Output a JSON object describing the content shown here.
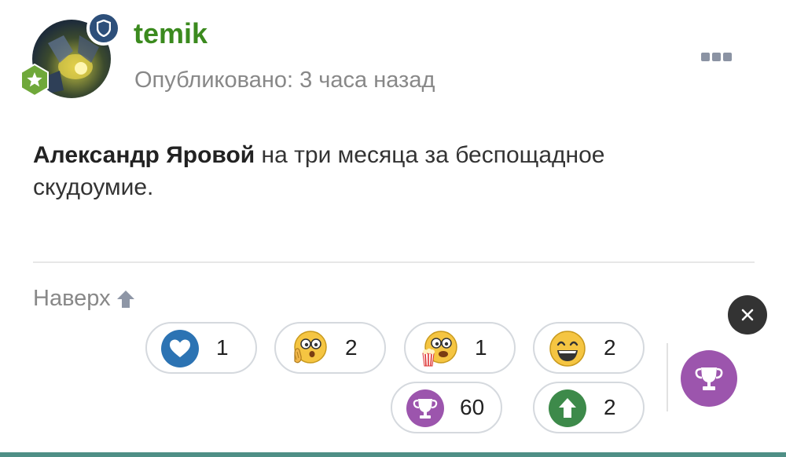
{
  "post": {
    "username": "temik",
    "published": "Опубликовано: 3 часа назад",
    "text_bold": "Александр Яровой",
    "text_rest": " на три месяца за беспощадное скудоумие."
  },
  "nav": {
    "to_top": "Наверх"
  },
  "reactions": [
    {
      "name": "heart",
      "count": "1",
      "color": "#2c73b3"
    },
    {
      "name": "shocked-face",
      "count": "2",
      "color": "#f5c542"
    },
    {
      "name": "popcorn-face",
      "count": "1",
      "color": "#f5c542"
    },
    {
      "name": "laughing-face",
      "count": "2",
      "color": "#f5c542"
    },
    {
      "name": "trophy",
      "count": "60",
      "color": "#9c55ad"
    },
    {
      "name": "upvote",
      "count": "2",
      "color": "#3d8a4a"
    }
  ],
  "colors": {
    "username": "#3b8a1e",
    "accent": "#9c55ad",
    "bottom_bar": "#4f8f86"
  }
}
